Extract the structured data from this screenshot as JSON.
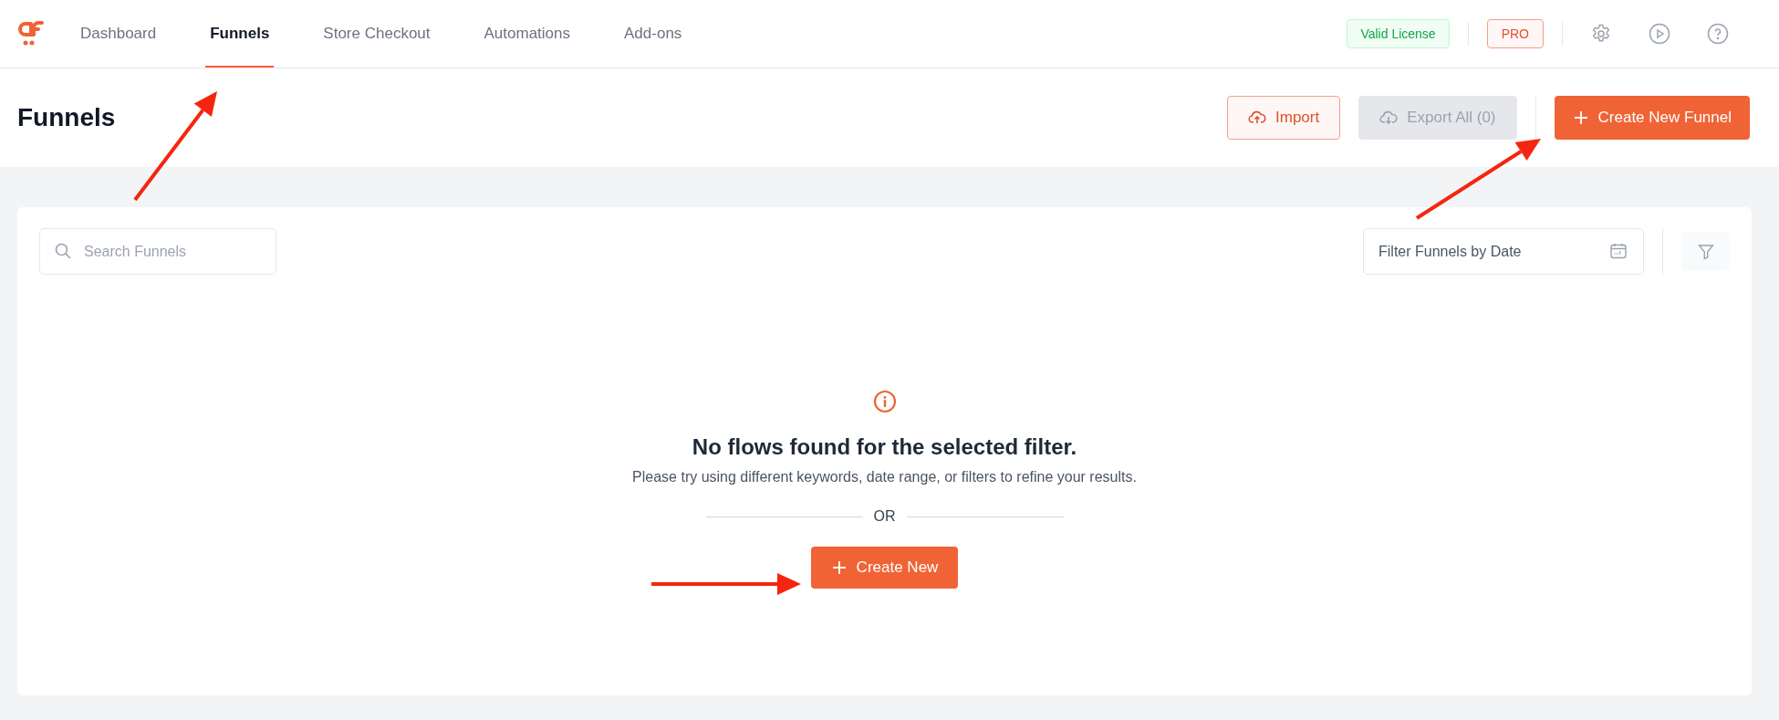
{
  "nav": {
    "items": [
      {
        "label": "Dashboard",
        "selected": false
      },
      {
        "label": "Funnels",
        "selected": true
      },
      {
        "label": "Store Checkout",
        "selected": false
      },
      {
        "label": "Automations",
        "selected": false
      },
      {
        "label": "Add-ons",
        "selected": false
      }
    ]
  },
  "license_badge": "Valid License",
  "plan_badge": "PRO",
  "header": {
    "title": "Funnels",
    "buttons": [
      {
        "label": "Import",
        "kind": "import",
        "disabled": false
      },
      {
        "label": "Export All (0)",
        "kind": "export",
        "disabled": true
      },
      {
        "label": "Create New Funnel",
        "kind": "create",
        "disabled": false
      }
    ]
  },
  "toolbar": {
    "search": {
      "placeholder": "Search Funnels"
    },
    "date_filter": {
      "placeholder": "Filter Funnels by Date"
    }
  },
  "empty_state": {
    "title": "No flows found for the selected filter.",
    "message": "Please try using different keywords, date range, or filters to refine your results.",
    "divider_label": "OR",
    "button": "Create New"
  }
}
